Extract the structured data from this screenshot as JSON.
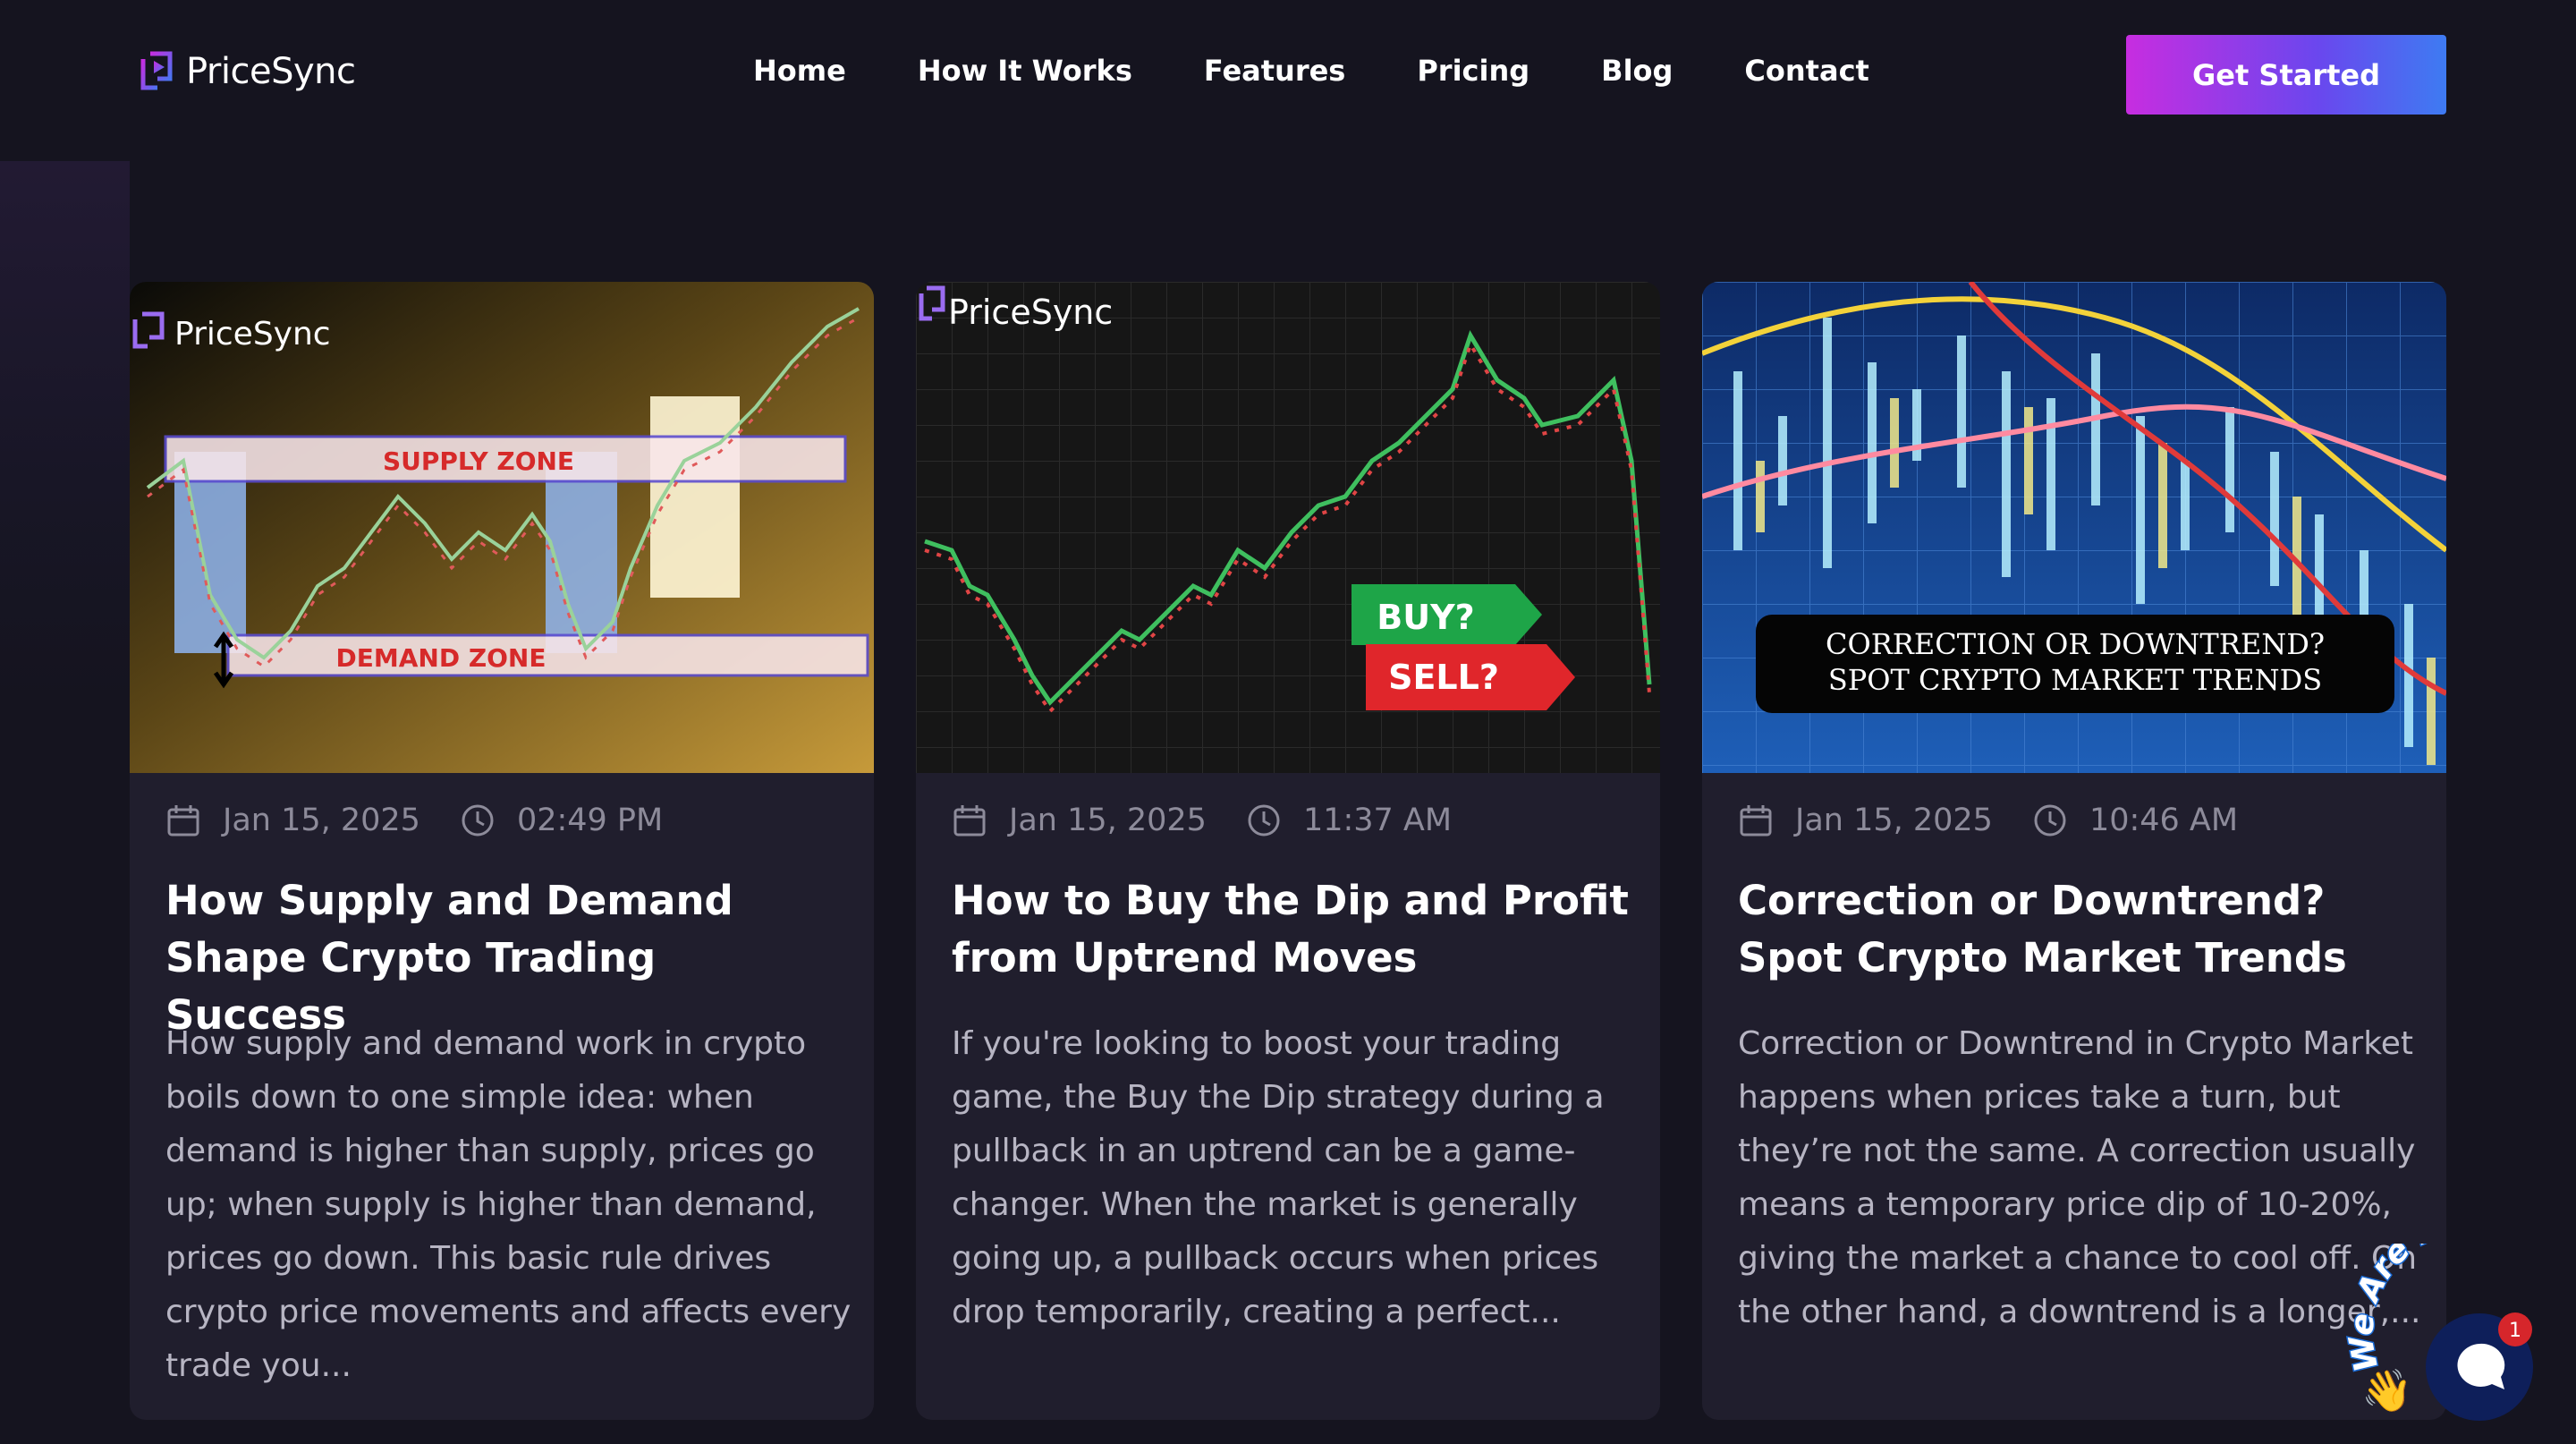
{
  "header": {
    "brand": "PriceSync",
    "nav": [
      "Home",
      "How It Works",
      "Features",
      "Pricing",
      "Blog",
      "Contact"
    ],
    "cta_label": "Get Started"
  },
  "posts": [
    {
      "date": "Jan 15, 2025",
      "time": "02:49 PM",
      "title": "How Supply and Demand Shape Crypto Trading Success",
      "excerpt": "How supply and demand work in crypto boils down to one simple idea: when demand is higher than supply, prices go up; when supply is higher than demand, prices go down. This basic rule drives crypto price movements and affects every trade you...",
      "image": {
        "brand": "PriceSync",
        "supply_label": "SUPPLY ZONE",
        "demand_label": "DEMAND ZONE"
      }
    },
    {
      "date": "Jan 15, 2025",
      "time": "11:37 AM",
      "title": "How to Buy the Dip and Profit from Uptrend Moves",
      "excerpt": "If you're looking to boost your trading game, the Buy the Dip strategy during a pullback in an uptrend can be a game-changer. When the market is generally going up, a pullback occurs when prices drop temporarily, creating a perfect...",
      "image": {
        "brand": "PriceSync",
        "buy_label": "BUY?",
        "sell_label": "SELL?"
      }
    },
    {
      "date": "Jan 15, 2025",
      "time": "10:46 AM",
      "title": "Correction or Downtrend? Spot Crypto Market Trends",
      "excerpt": "Correction or Downtrend in Crypto Market happens when prices take a turn, but they’re not the same. A correction usually means a temporary price dip of 10-20%, giving the market a chance to cool off. On the other hand, a downtrend is a longer,...",
      "image": {
        "caption_line1": "CORRECTION OR DOWNTREND?",
        "caption_line2": "SPOT CRYPTO MARKET TRENDS"
      }
    }
  ],
  "chat": {
    "label": "We Are Here!",
    "badge": "1"
  }
}
